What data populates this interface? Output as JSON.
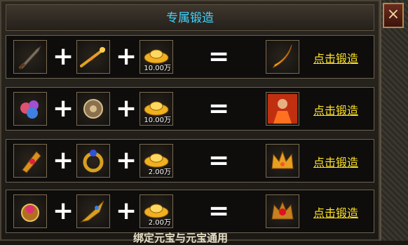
{
  "window": {
    "title": "专属锻造",
    "close_icon": "×"
  },
  "operators": {
    "plus": "+",
    "equals": "="
  },
  "rows": [
    {
      "input1": {
        "icon": "sword-icon"
      },
      "input2": {
        "icon": "rod-icon"
      },
      "cost": {
        "icon": "gold-ingot-icon",
        "amount": "10.00万"
      },
      "result": {
        "icon": "blade-icon"
      },
      "action_label": "点击锻造"
    },
    {
      "input1": {
        "icon": "coral-gem-icon"
      },
      "input2": {
        "icon": "ornament-icon"
      },
      "cost": {
        "icon": "gold-ingot-icon",
        "amount": "10.00万"
      },
      "result": {
        "icon": "warrior-portrait-icon"
      },
      "action_label": "点击锻造"
    },
    {
      "input1": {
        "icon": "bracer-icon"
      },
      "input2": {
        "icon": "ring-icon"
      },
      "cost": {
        "icon": "gold-ingot-icon",
        "amount": "2.00万"
      },
      "result": {
        "icon": "crown-icon"
      },
      "action_label": "点击锻造"
    },
    {
      "input1": {
        "icon": "jeweled-ring-icon"
      },
      "input2": {
        "icon": "dragon-weapon-icon"
      },
      "cost": {
        "icon": "gold-ingot-icon",
        "amount": "2.00万"
      },
      "result": {
        "icon": "ruby-crown-icon"
      },
      "action_label": "点击锻造"
    }
  ],
  "footer_note": "绑定元宝与元宝通用",
  "colors": {
    "title": "#3fd4ff",
    "link": "#ffe326",
    "gold": "#f0b020"
  }
}
